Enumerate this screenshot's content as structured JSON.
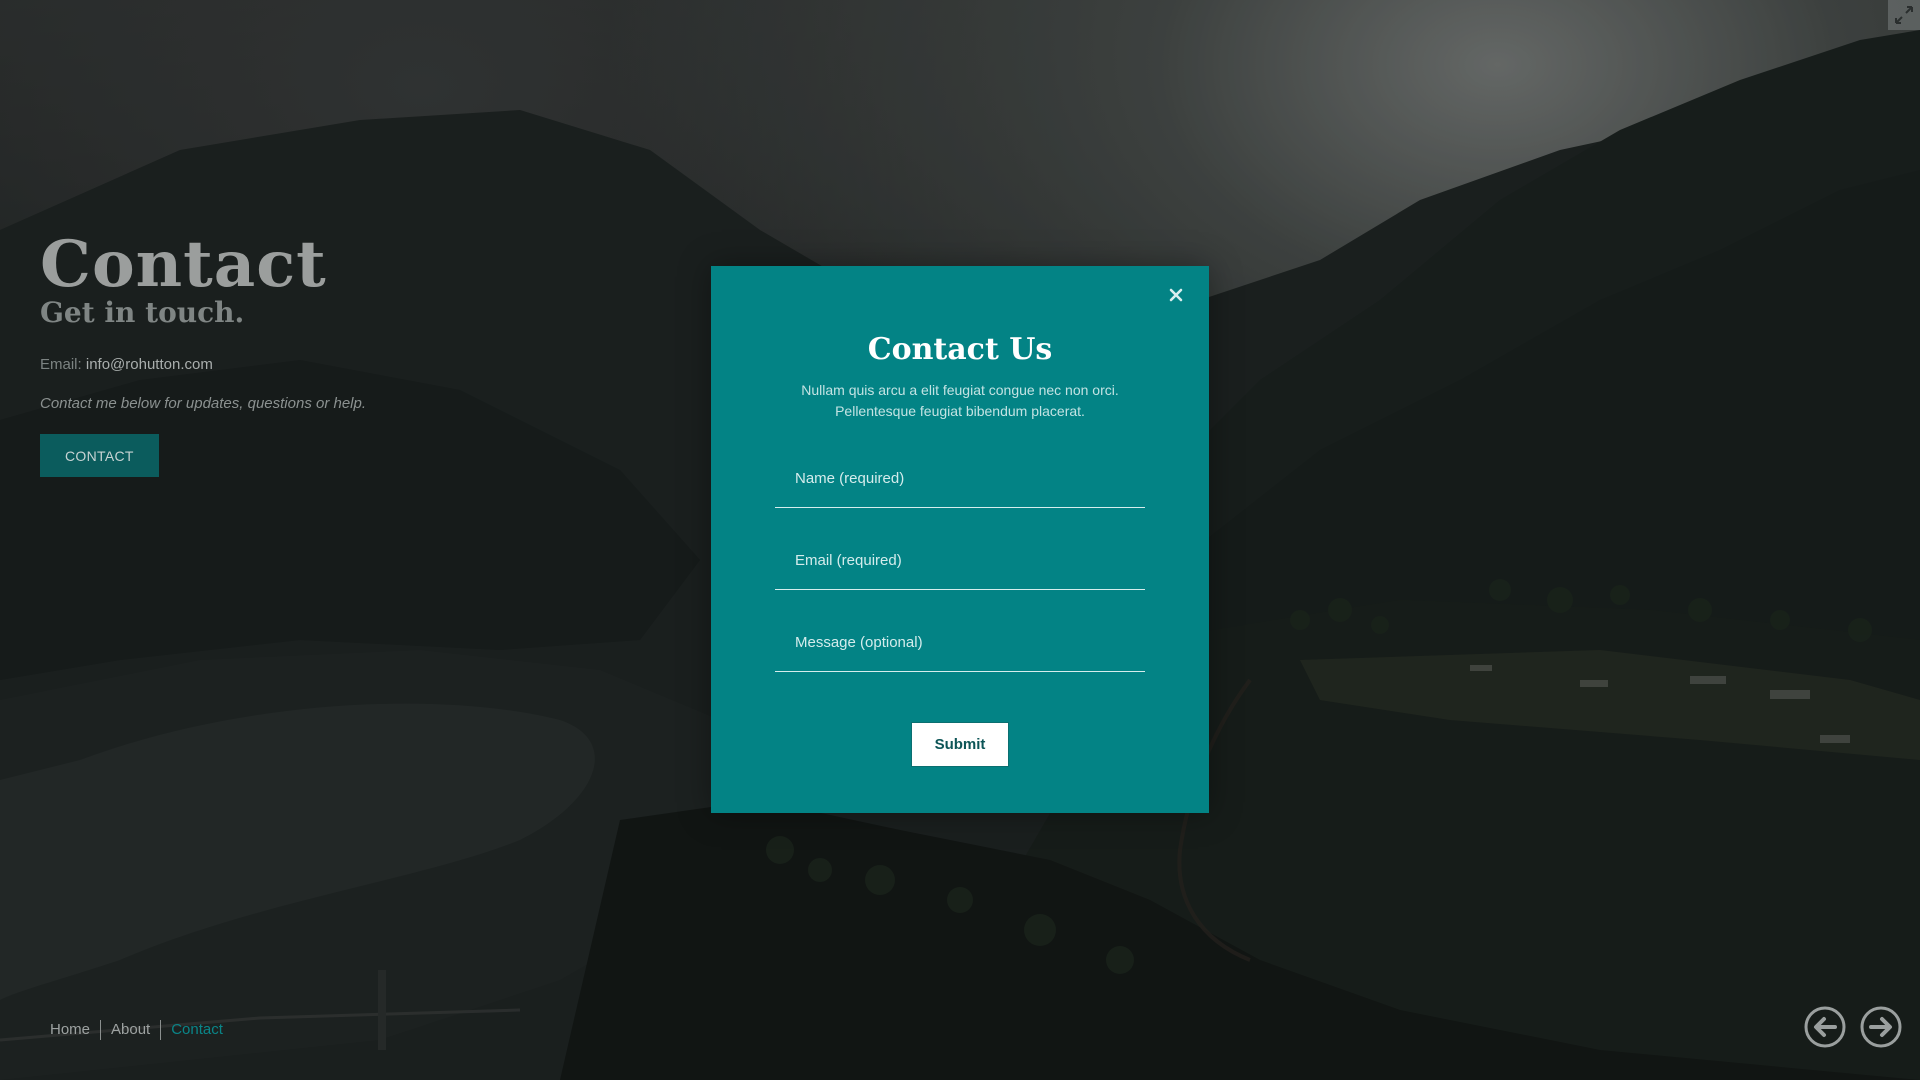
{
  "hero": {
    "title": "Contact",
    "subtitle": "Get in touch.",
    "email_label": "Email:",
    "email_value": "info@rohutton.com",
    "note": "Contact me below for updates, questions or help.",
    "button_label": "CONTACT"
  },
  "modal": {
    "title": "Contact Us",
    "description": "Nullam quis arcu a elit feugiat congue nec non orci. Pellentesque feugiat bibendum placerat.",
    "fields": {
      "name_placeholder": "Name (required)",
      "email_placeholder": "Email (required)",
      "message_placeholder": "Message (optional)"
    },
    "submit_label": "Submit",
    "close_icon": "close-icon"
  },
  "nav": {
    "items": [
      "Home",
      "About",
      "Contact"
    ],
    "active": "Contact"
  },
  "icons": {
    "fullscreen": "fullscreen-toggle-icon",
    "prev": "arrow-left-circle-icon",
    "next": "arrow-right-circle-icon"
  },
  "colors": {
    "accent": "#038385",
    "hero_button": "#0b5c5d",
    "active_nav": "#0a8588"
  }
}
